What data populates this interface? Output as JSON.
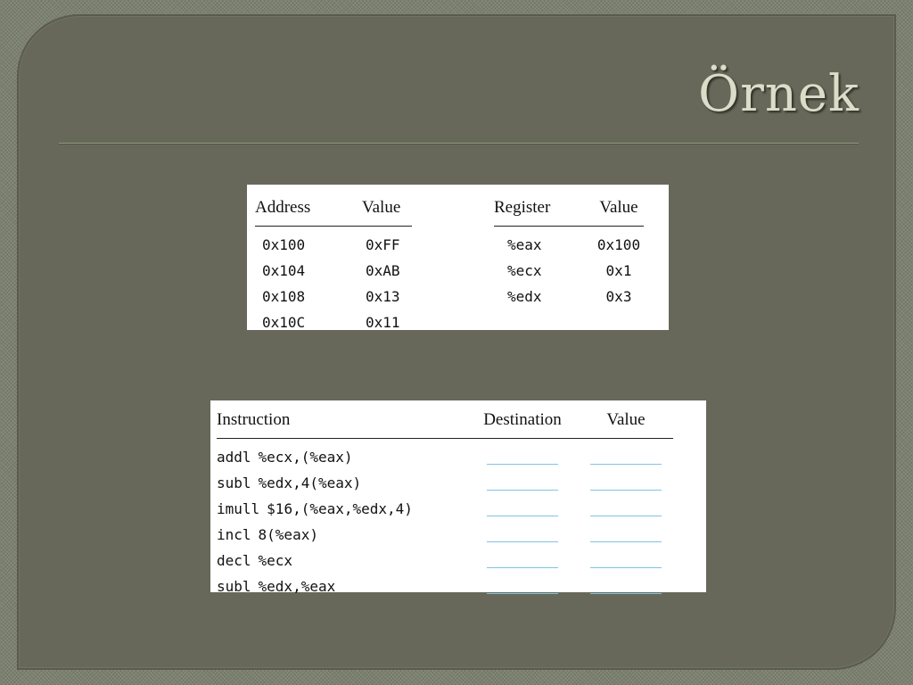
{
  "slide": {
    "title": "Örnek"
  },
  "memory_table": {
    "headers": {
      "address": "Address",
      "value": "Value"
    },
    "rows": [
      {
        "address": "0x100",
        "value": "0xFF"
      },
      {
        "address": "0x104",
        "value": "0xAB"
      },
      {
        "address": "0x108",
        "value": "0x13"
      },
      {
        "address": "0x10C",
        "value": "0x11"
      }
    ]
  },
  "register_table": {
    "headers": {
      "register": "Register",
      "value": "Value"
    },
    "rows": [
      {
        "register": "%eax",
        "value": "0x100"
      },
      {
        "register": "%ecx",
        "value": "0x1"
      },
      {
        "register": "%edx",
        "value": "0x3"
      }
    ]
  },
  "instruction_table": {
    "headers": {
      "instruction": "Instruction",
      "destination": "Destination",
      "value": "Value"
    },
    "rows": [
      {
        "op": "addl",
        "args": "%ecx,(%eax)"
      },
      {
        "op": "subl",
        "args": "%edx,4(%eax)"
      },
      {
        "op": "imull",
        "args": "$16,(%eax,%edx,4)"
      },
      {
        "op": "incl",
        "args": "8(%eax)"
      },
      {
        "op": "decl",
        "args": "%ecx"
      },
      {
        "op": "subl",
        "args": "%edx,%eax"
      }
    ]
  },
  "colors": {
    "panel": "#676859",
    "title": "#dcdcc8",
    "blank_line": "#7ec4e6"
  }
}
